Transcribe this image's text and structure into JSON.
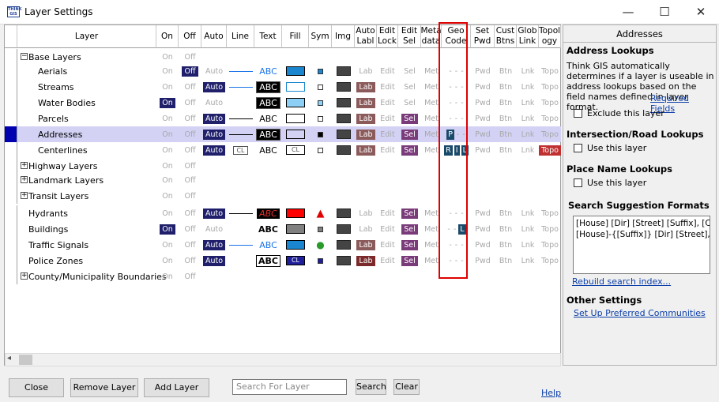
{
  "window": {
    "title": "Layer Settings",
    "minimize": "—",
    "maximize": "☐",
    "close": "✕",
    "app_icon_text": "THINK GIS"
  },
  "columns": [
    {
      "key": "layer",
      "label": "Layer"
    },
    {
      "key": "on",
      "label": "On"
    },
    {
      "key": "off",
      "label": "Off"
    },
    {
      "key": "auto",
      "label": "Auto"
    },
    {
      "key": "line",
      "label": "Line"
    },
    {
      "key": "text",
      "label": "Text"
    },
    {
      "key": "fill",
      "label": "Fill"
    },
    {
      "key": "sym",
      "label": "Sym"
    },
    {
      "key": "img",
      "label": "Img"
    },
    {
      "key": "autolabl",
      "label": "Auto\nLabl"
    },
    {
      "key": "editlock",
      "label": "Edit\nLock"
    },
    {
      "key": "editsel",
      "label": "Edit\nSel"
    },
    {
      "key": "metadata",
      "label": "Meta\ndata"
    },
    {
      "key": "geocode",
      "label": "Geo\nCode"
    },
    {
      "key": "setpwd",
      "label": "Set\nPwd"
    },
    {
      "key": "custbtns",
      "label": "Cust\nBtns"
    },
    {
      "key": "globlink",
      "label": "Glob\nLink"
    },
    {
      "key": "topology",
      "label": "Topol\nogy"
    }
  ],
  "rows": [
    {
      "name": "Base Layers",
      "group": true,
      "expand": "−",
      "indent": 0,
      "on": "On",
      "off": "Off"
    },
    {
      "name": "Aerials",
      "indent": 1,
      "on": "On",
      "off": "Off",
      "off_active": true,
      "auto": "Auto",
      "line": "blue",
      "text": "ABC",
      "text_style": "blue",
      "fill": "#1a86d0",
      "sym": "#1a86d0",
      "img": true,
      "lab": "Lab",
      "lock": "Edit",
      "sel": "Sel",
      "met": "Met",
      "geo": "- - -",
      "pwd": "Pwd",
      "btn": "Btn",
      "lnk": "Lnk",
      "topo": "Topo"
    },
    {
      "name": "Streams",
      "indent": 1,
      "on": "On",
      "off": "Off",
      "auto": "Auto",
      "auto_active": true,
      "line": "blue",
      "text": "ABC",
      "text_style": "black",
      "fill": "#ffffff",
      "fill_border": "#1a86d0",
      "sym": "#ffffff",
      "img": true,
      "lab": "Lab",
      "lab_active": true,
      "lock": "Edit",
      "sel": "Sel",
      "met": "Met",
      "geo": "- - -",
      "pwd": "Pwd",
      "btn": "Btn",
      "lnk": "Lnk",
      "topo": "Topo"
    },
    {
      "name": "Water Bodies",
      "indent": 1,
      "on": "On",
      "on_active": true,
      "off": "Off",
      "auto": "Auto",
      "line": "none",
      "text": "ABC",
      "text_style": "black",
      "fill": "#8ecff5",
      "sym": "#8ecff5",
      "img": true,
      "lab": "Lab",
      "lab_active": true,
      "lock": "Edit",
      "sel": "Sel",
      "met": "Met",
      "geo": "- - -",
      "pwd": "Pwd",
      "btn": "Btn",
      "lnk": "Lnk",
      "topo": "Topo"
    },
    {
      "name": "Parcels",
      "indent": 1,
      "on": "On",
      "off": "Off",
      "auto": "Auto",
      "auto_active": true,
      "line": "black",
      "text": "ABC",
      "text_style": "plain",
      "fill": "#ffffff",
      "sym": "#ffffff",
      "img": true,
      "lab": "Lab",
      "lab_active": true,
      "lock": "Edit",
      "sel": "Sel",
      "sel_active": true,
      "met": "Met",
      "geo": "- - -",
      "pwd": "Pwd",
      "btn": "Btn",
      "lnk": "Lnk",
      "topo": "Topo"
    },
    {
      "name": "Addresses",
      "indent": 1,
      "selected": true,
      "on": "On",
      "off": "Off",
      "auto": "Auto",
      "auto_active": true,
      "line": "black",
      "text": "ABC",
      "text_style": "black",
      "fill": "#d3d2f5",
      "sym": "#000000",
      "img": true,
      "lab": "Lab",
      "lab_active": true,
      "lock": "Edit",
      "sel": "Sel",
      "sel_active": true,
      "met": "Met",
      "geo": "P - -",
      "geo_badges": [
        "P"
      ],
      "pwd": "Pwd",
      "btn": "Btn",
      "lnk": "Lnk",
      "topo": "Topo"
    },
    {
      "name": "Centerlines",
      "indent": 1,
      "on": "On",
      "off": "Off",
      "auto": "Auto",
      "auto_active": true,
      "line": "cl",
      "line_label": "CL",
      "text": "ABC",
      "text_style": "plain",
      "fill": "#ffffff",
      "fill_label": "CL",
      "sym": "#ffffff",
      "img": true,
      "lab": "Lab",
      "lab_active": true,
      "lock": "Edit",
      "sel": "Sel",
      "sel_active": true,
      "met": "Met",
      "geo": "R I L",
      "geo_badges": [
        "R",
        "I",
        "L"
      ],
      "pwd": "Pwd",
      "btn": "Btn",
      "lnk": "Lnk",
      "topo": "Topo",
      "topo_active": true
    },
    {
      "name": "Highway Layers",
      "group": true,
      "expand": "+",
      "indent": 0,
      "on": "On",
      "off": "Off"
    },
    {
      "name": "Landmark Layers",
      "group": true,
      "expand": "+",
      "indent": 0,
      "on": "On",
      "off": "Off"
    },
    {
      "name": "Transit Layers",
      "group": true,
      "expand": "+",
      "indent": 0,
      "on": "On",
      "off": "Off"
    },
    {
      "name": "Hydrants",
      "indent": 0,
      "on": "On",
      "off": "Off",
      "auto": "Auto",
      "auto_active": true,
      "line": "black",
      "text": "ABC",
      "text_style": "red",
      "fill": "#ff0000",
      "sym": "hydrant",
      "img": true,
      "lab": "Lab",
      "lock": "Edit",
      "sel": "Sel",
      "sel_active": true,
      "met": "Met",
      "geo": "- - -",
      "pwd": "Pwd",
      "btn": "Btn",
      "lnk": "Lnk",
      "topo": "Topo"
    },
    {
      "name": "Buildings",
      "indent": 0,
      "on": "On",
      "on_active": true,
      "off": "Off",
      "auto": "Auto",
      "line": "none",
      "text": "ABC",
      "text_style": "bold",
      "fill": "#808080",
      "sym": "#808080",
      "img": true,
      "lab": "Lab",
      "lock": "Edit",
      "sel": "Sel",
      "sel_active": true,
      "met": "Met",
      "geo": "- - L",
      "geo_badges": [
        "L"
      ],
      "pwd": "Pwd",
      "btn": "Btn",
      "lnk": "Lnk",
      "topo": "Topo"
    },
    {
      "name": "Traffic Signals",
      "indent": 0,
      "on": "On",
      "off": "Off",
      "auto": "Auto",
      "auto_active": true,
      "line": "blue",
      "text": "ABC",
      "text_style": "blue",
      "fill": "#1a86d0",
      "sym": "signal",
      "img": true,
      "lab": "Lab",
      "lab_active": true,
      "lock": "Edit",
      "sel": "Sel",
      "sel_active": true,
      "met": "Met",
      "geo": "- - -",
      "pwd": "Pwd",
      "btn": "Btn",
      "lnk": "Lnk",
      "topo": "Topo"
    },
    {
      "name": "Police Zones",
      "indent": 0,
      "on": "On",
      "off": "Off",
      "auto": "Auto",
      "auto_active": true,
      "line": "none",
      "text": "ABC",
      "text_style": "outline",
      "fill": "#1f1f9a",
      "fill_label": "CL",
      "sym": "#1f1f9a",
      "img": true,
      "lab": "Lab",
      "lab_active": true,
      "lab_dark": true,
      "lock": "Edit",
      "sel": "Sel",
      "sel_active": true,
      "met": "Met",
      "geo": "- - -",
      "pwd": "Pwd",
      "btn": "Btn",
      "lnk": "Lnk",
      "topo": "Topo"
    },
    {
      "name": "County/Municipality Boundaries",
      "group": true,
      "expand": "+",
      "indent": 0,
      "on": "On",
      "off": "Off"
    }
  ],
  "panel": {
    "title": "Addresses",
    "address_lookups": {
      "heading": "Address Lookups",
      "desc": "Think GIS automatically determines if a layer is useable in address lookups based on the field names defined in layer format.",
      "link": "Required Fields",
      "checkbox": "Exclude this layer"
    },
    "intersection": {
      "heading": "Intersection/Road Lookups",
      "checkbox": "Use this layer"
    },
    "place_name": {
      "heading": "Place Name Lookups",
      "checkbox": "Use this layer"
    },
    "suggestions": {
      "heading": "Search Suggestion Formats",
      "lines": [
        "[House] [Dir] [Street] [Suffix], [Co",
        "[House]-{[Suffix]} [Dir] [Street], [C"
      ],
      "rebuild": "Rebuild search index..."
    },
    "other": {
      "heading": "Other Settings",
      "link": "Set Up Preferred Communities"
    }
  },
  "footer": {
    "close": "Close",
    "remove": "Remove Layer",
    "add": "Add Layer",
    "search_placeholder": "Search For Layer",
    "search": "Search",
    "clear": "Clear",
    "help": "Help"
  }
}
